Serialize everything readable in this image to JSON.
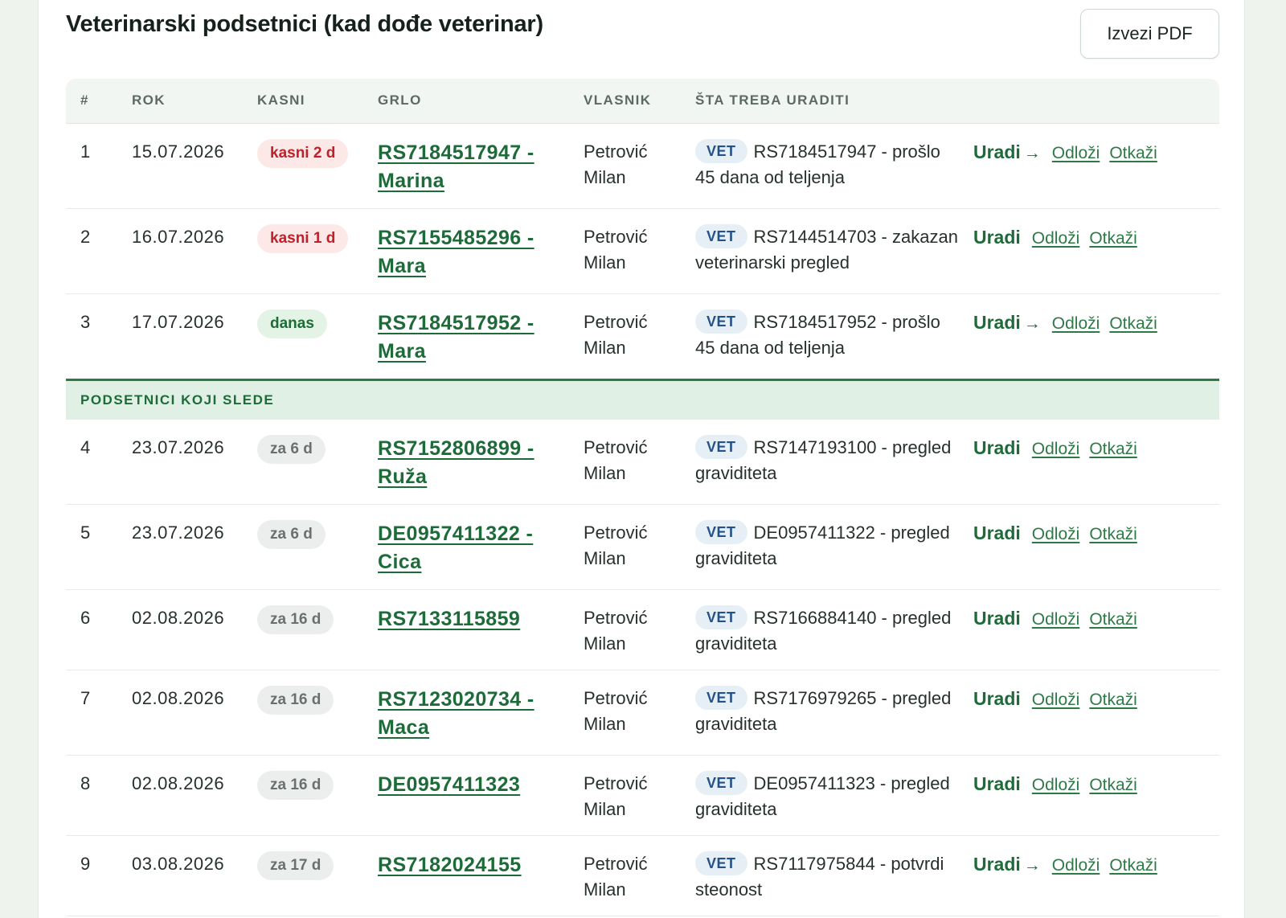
{
  "header": {
    "title": "Veterinarski podsetnici (kad dođe veterinar)",
    "export_label": "Izvezi PDF"
  },
  "table": {
    "columns": [
      "#",
      "ROK",
      "KASNI",
      "GRLO",
      "VLASNIK",
      "ŠTA TREBA URADITI",
      ""
    ],
    "vet_tag": "VET",
    "do_label": "Uradi",
    "do_arrow": "→",
    "postpone_label": "Odloži",
    "cancel_label": "Otkaži",
    "section_label": "PODSETNICI KOJI SLEDE",
    "rows": [
      {
        "num": "1",
        "date": "15.07.2026",
        "status": "kasni 2 d",
        "status_type": "late",
        "animal": "RS7184517947 - Marina",
        "owner": "Petrović Milan",
        "task": "RS7184517947 - prošlo 45 dana od teljenja",
        "arrow": true
      },
      {
        "num": "2",
        "date": "16.07.2026",
        "status": "kasni 1 d",
        "status_type": "late",
        "animal": "RS7155485296 - Mara",
        "owner": "Petrović Milan",
        "task": "RS7144514703 - zakazan veterinarski pregled",
        "arrow": false
      },
      {
        "num": "3",
        "date": "17.07.2026",
        "status": "danas",
        "status_type": "today",
        "animal": "RS7184517952 - Mara",
        "owner": "Petrović Milan",
        "task": "RS7184517952 - prošlo 45 dana od teljenja",
        "arrow": true
      },
      {
        "num": "4",
        "date": "23.07.2026",
        "status": "za 6 d",
        "status_type": "future",
        "animal": "RS7152806899 - Ruža",
        "owner": "Petrović Milan",
        "task": "RS7147193100 - pregled graviditeta",
        "arrow": false
      },
      {
        "num": "5",
        "date": "23.07.2026",
        "status": "za 6 d",
        "status_type": "future",
        "animal": "DE0957411322 - Cica",
        "owner": "Petrović Milan",
        "task": "DE0957411322 - pregled graviditeta",
        "arrow": false
      },
      {
        "num": "6",
        "date": "02.08.2026",
        "status": "za 16 d",
        "status_type": "future",
        "animal": "RS7133115859",
        "owner": "Petrović Milan",
        "task": "RS7166884140 - pregled graviditeta",
        "arrow": false
      },
      {
        "num": "7",
        "date": "02.08.2026",
        "status": "za 16 d",
        "status_type": "future",
        "animal": "RS7123020734 - Maca",
        "owner": "Petrović Milan",
        "task": "RS7176979265 - pregled graviditeta",
        "arrow": false
      },
      {
        "num": "8",
        "date": "02.08.2026",
        "status": "za 16 d",
        "status_type": "future",
        "animal": "DE0957411323",
        "owner": "Petrović Milan",
        "task": "DE0957411323 - pregled graviditeta",
        "arrow": false
      },
      {
        "num": "9",
        "date": "03.08.2026",
        "status": "za 17 d",
        "status_type": "future",
        "animal": "RS7182024155",
        "owner": "Petrović Milan",
        "task": "RS7117975844 - potvrdi steonost",
        "arrow": true
      }
    ]
  },
  "colors": {
    "accent_green": "#1e6b3a",
    "late_red": "#c0202a",
    "vet_blue": "#23518a"
  }
}
